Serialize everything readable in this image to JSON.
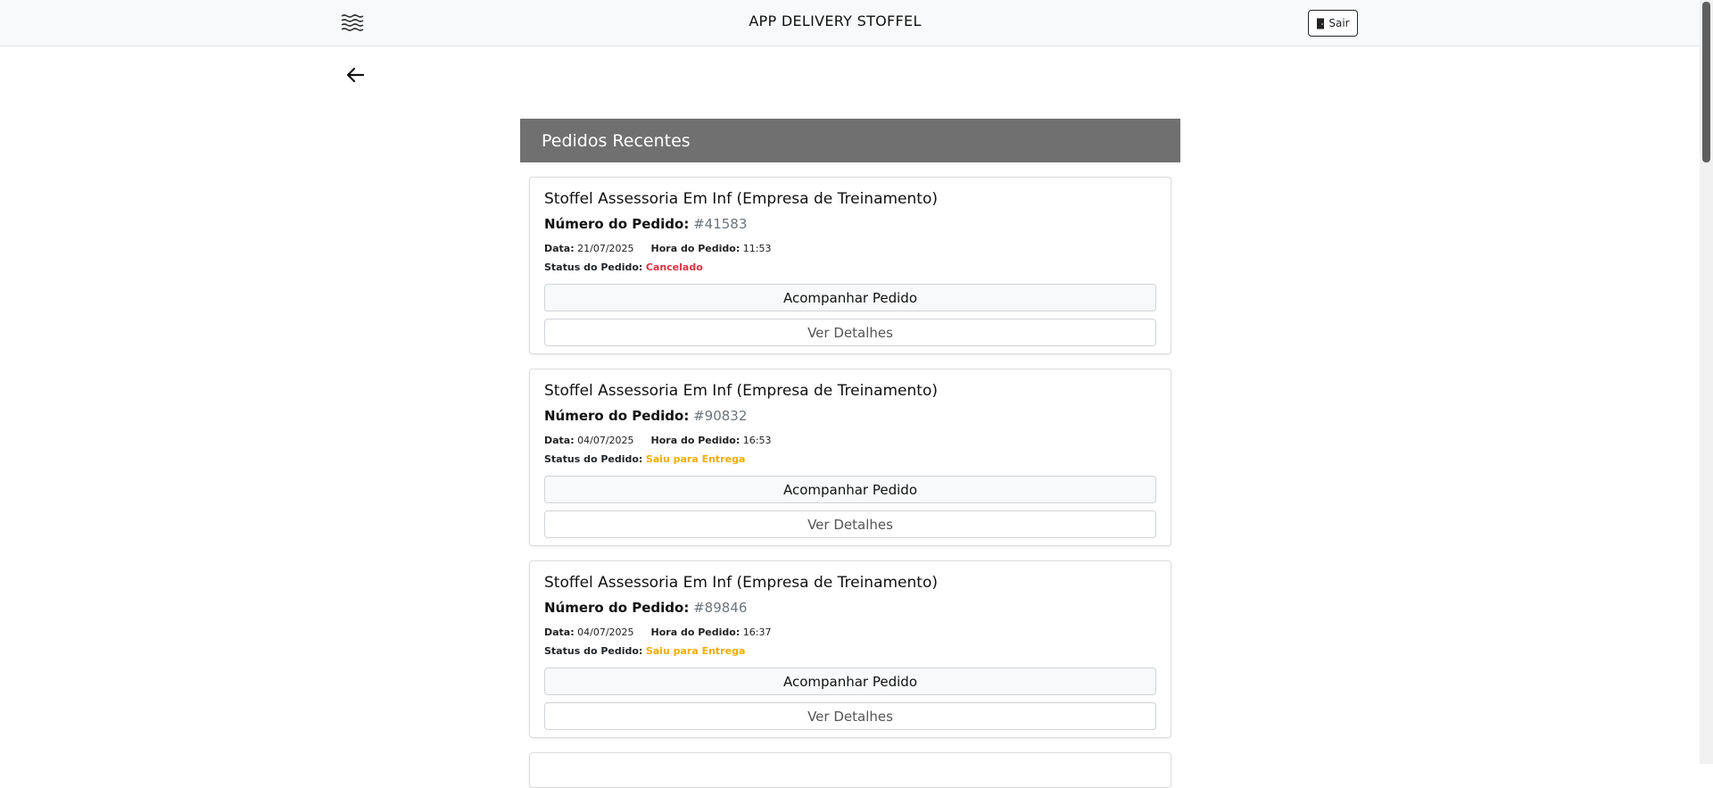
{
  "header": {
    "title": "APP DELIVERY STOFFEL",
    "logout_label": "Sair",
    "menu_icon": "hamburger-icon",
    "logout_icon": "door-icon"
  },
  "back_icon": "arrow-left-icon",
  "section": {
    "title": "Pedidos Recentes"
  },
  "labels": {
    "order_number": "Número do Pedido:",
    "date": "Data:",
    "time": "Hora do Pedido:",
    "status": "Status do Pedido:",
    "track_button": "Acompanhar Pedido",
    "details_button": "Ver Detalhes"
  },
  "orders": [
    {
      "store": "Stoffel Assessoria Em Inf (Empresa de Treinamento)",
      "number": "#41583",
      "date": "21/07/2025",
      "time": "11:53",
      "status": "Cancelado",
      "status_color": "#dc3545"
    },
    {
      "store": "Stoffel Assessoria Em Inf (Empresa de Treinamento)",
      "number": "#90832",
      "date": "04/07/2025",
      "time": "16:53",
      "status": "Saiu para Entrega",
      "status_color": "#f0ad00"
    },
    {
      "store": "Stoffel Assessoria Em Inf (Empresa de Treinamento)",
      "number": "#89846",
      "date": "04/07/2025",
      "time": "16:37",
      "status": "Saiu para Entrega",
      "status_color": "#f0ad00"
    }
  ]
}
